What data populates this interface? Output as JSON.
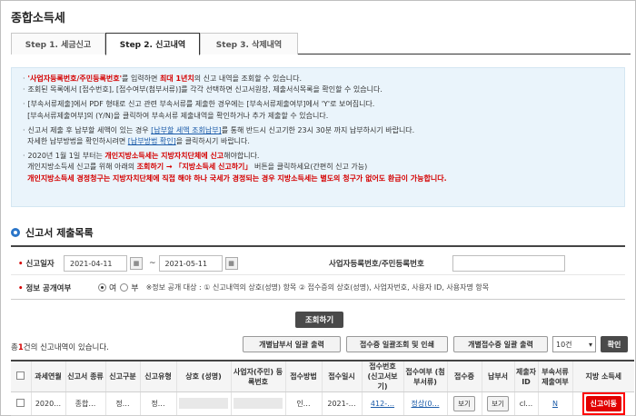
{
  "page": {
    "title": "종합소득세"
  },
  "tabs": [
    {
      "label": "Step 1. 세금신고"
    },
    {
      "label": "Step 2. 신고내역"
    },
    {
      "label": "Step 3. 삭제내역"
    }
  ],
  "info": {
    "l1a": "'사업자등록번호/주민등록번호'",
    "l1b": "를 입력하면 ",
    "l1c": "최대 1년치",
    "l1d": "의 신고 내역을 조회할 수 있습니다.",
    "l2": "조회된 목록에서 [접수번호], [접수여부(첨부서류)]를 각각 선택하면 신고서원장, 제출서식목록을 확인할 수 있습니다.",
    "l3": "[부속서류제출]에서 PDF 형태로 신고 관련 부속서류를 제출한 경우에는 [부속서류제출여부]에서 'Y'로 보여집니다.",
    "l4": "[부속서류제출여부]의 (Y/N)을 클릭하여 부속서류 제출내역을 확인하거나 추가 제출할 수 있습니다.",
    "l5a": "신고서 제출 후 납부할 세액이 있는 경우 ",
    "l5b": "[납부할 세액 조회납부]",
    "l5c": "를 통해 반드시 신고기한 23시 30분 까지 납부하시기 바랍니다.",
    "l6a": "자세한 납부방법을 확인하시려면 ",
    "l6b": "[납부방법 확인]",
    "l6c": "을 클릭하시기 바랍니다.",
    "l7a": "2020년 1월 1일 부터는 ",
    "l7b": "개인지방소득세는 지방자치단체에 신고",
    "l7c": "해야합니다.",
    "l8a": "개인지방소득세 신고를 위해 아래의 ",
    "l8b": "조회하기 → 「지방소득세 신고하기」",
    "l8c": " 버튼을 클릭하세요(간편히 신고 가능)",
    "l9": "개인지방소득세 경정청구는 지방자치단체에 직접 해야 하나 국세가 경정되는 경우 지방소득세는 별도의 청구가 없어도 환급이 가능합니다."
  },
  "section": {
    "title": "신고서 제출목록"
  },
  "search": {
    "date_label": "신고일자",
    "date_from": "2021-04-11",
    "date_to": "2021-05-11",
    "biz_label": "사업자등록번호/주민등록번호",
    "public_label": "정보 공개여부",
    "opt_yes": "여",
    "opt_no": "부",
    "public_note": "※정보 공개 대상 : ① 신고내역의 상호(성명) 항목 ② 접수증의 상호(성명), 사업자번호, 사용자 ID, 사용자명 항목",
    "button": "조회하기"
  },
  "results": {
    "count_pre": "총",
    "count": "1",
    "count_post": "건의 신고내역이 있습니다.",
    "btn_batch_tax": "개별납부서 일괄 출력",
    "btn_receipt": "접수증 일괄조회 및 인쇄",
    "btn_batch_receipt": "개별접수증 일괄 출력",
    "page_size": "10건",
    "confirm": "확인"
  },
  "table": {
    "headers": [
      "",
      "과세연월",
      "신고서 종류",
      "신고구분",
      "신고유형",
      "상호 (성명)",
      "사업자(주민) 등록번호",
      "접수방법",
      "접수일시",
      "접수번호 (신고서보기)",
      "접수여부 (첨부서류)",
      "접수증",
      "납부서",
      "제출자 ID",
      "부속서류 제출여부",
      "지방 소득세"
    ],
    "row": {
      "period": "2020…",
      "type": "종합…",
      "category": "정…",
      "kind": "정…",
      "method": "인…",
      "datetime": "2021-…",
      "receipt_no": "412-…",
      "status": "정상(0…",
      "receipt_btn": "보기",
      "bill_btn": "보기",
      "submitter": "cl…",
      "attach": "N",
      "move_btn": "신고이동"
    }
  }
}
